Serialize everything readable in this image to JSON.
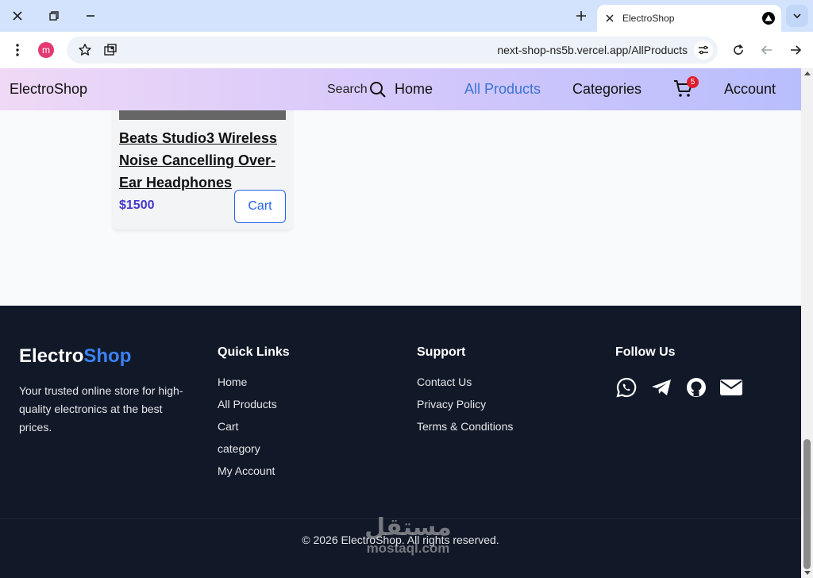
{
  "browser": {
    "tab_title": "ElectroShop",
    "url": "next-shop-ns5b.vercel.app/AllProducts",
    "profile_initial": "m"
  },
  "nav": {
    "logo": "ElectroShop",
    "search_label": "Search",
    "links": [
      "Home",
      "All Products",
      "Categories"
    ],
    "active_link": "All Products",
    "cart_count": "5",
    "account": "Account"
  },
  "product": {
    "title": "Beats Studio3 Wireless Noise Cancelling Over-Ear Headphones",
    "price": "$1500",
    "cart_label": "Cart"
  },
  "footer": {
    "brand_main": "Electro",
    "brand_accent": "Shop",
    "description": "Your trusted online store for high-quality electronics at the best prices.",
    "quick_links_title": "Quick Links",
    "quick_links": [
      "Home",
      "All Products",
      "Cart",
      "category",
      "My Account"
    ],
    "support_title": "Support",
    "support_links": [
      "Contact Us",
      "Privacy Policy",
      "Terms & Conditions"
    ],
    "follow_title": "Follow Us",
    "social": [
      "whatsapp-icon",
      "telegram-icon",
      "github-icon",
      "mail-icon"
    ],
    "copyright": "© 2026 ElectroShop. All rights reserved."
  },
  "watermark": {
    "arabic": "مستقل",
    "latin": "mostaql.com"
  },
  "colors": {
    "accent": "#3b82f6",
    "price": "#4338ca",
    "footer_bg": "#111827",
    "badge": "#e11d2e"
  }
}
